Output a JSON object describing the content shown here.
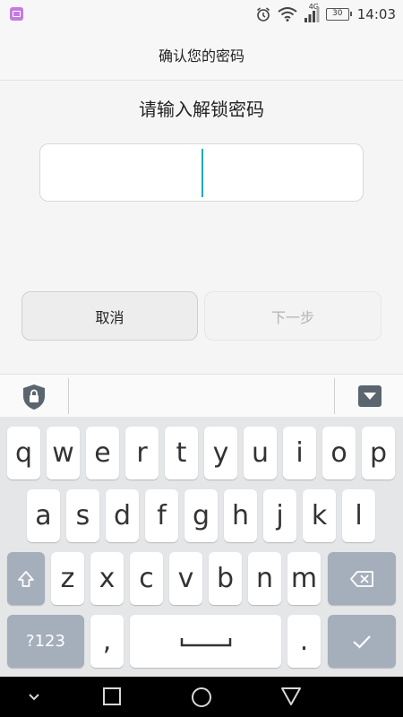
{
  "status_bar": {
    "network_type": "4G",
    "battery_level": "30",
    "time": "14:03"
  },
  "header": {
    "title": "确认您的密码"
  },
  "main": {
    "prompt": "请输入解锁密码",
    "password_value": "",
    "cancel_label": "取消",
    "next_label": "下一步"
  },
  "keyboard": {
    "row1": [
      "q",
      "w",
      "e",
      "r",
      "t",
      "y",
      "u",
      "i",
      "o",
      "p"
    ],
    "row2": [
      "a",
      "s",
      "d",
      "f",
      "g",
      "h",
      "j",
      "k",
      "l"
    ],
    "row3": [
      "z",
      "x",
      "c",
      "v",
      "b",
      "n",
      "m"
    ],
    "symbols_label": "?123",
    "comma_label": ",",
    "period_label": "."
  }
}
